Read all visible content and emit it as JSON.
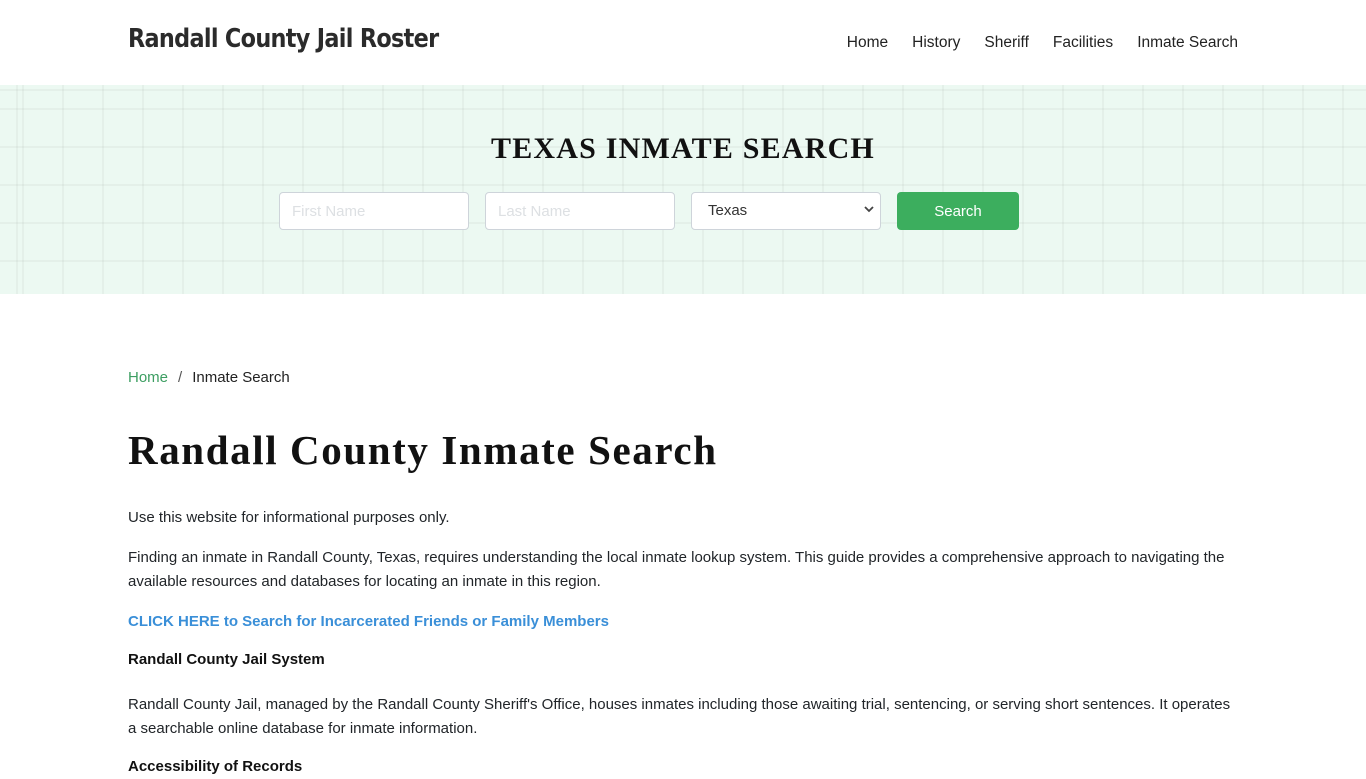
{
  "header": {
    "brand": "Randall County Jail Roster",
    "nav": [
      {
        "label": "Home"
      },
      {
        "label": "History"
      },
      {
        "label": "Sheriff"
      },
      {
        "label": "Facilities"
      },
      {
        "label": "Inmate Search"
      }
    ]
  },
  "hero": {
    "title": "TEXAS INMATE SEARCH",
    "first_name": {
      "placeholder": "First Name",
      "value": ""
    },
    "last_name": {
      "placeholder": "Last Name",
      "value": ""
    },
    "state_select": {
      "selected": "Texas",
      "icon": "chevron-down-icon"
    },
    "search_button": "Search",
    "colors": {
      "background": "#ecf9f2",
      "button": "#3cae5e"
    }
  },
  "breadcrumb": {
    "home": "Home",
    "separator": "/",
    "current": "Inmate Search"
  },
  "main": {
    "title": "Randall County Inmate Search",
    "intro": "Use this website for informational purposes only.",
    "paragraph1": "Finding an inmate in Randall County, Texas, requires understanding the local inmate lookup system. This guide provides a comprehensive approach to navigating the available resources and databases for locating an inmate in this region.",
    "cta_link": "CLICK HERE to Search for Incarcerated Friends or Family Members",
    "section1_heading": "Randall County Jail System",
    "section1_text": "Randall County Jail, managed by the Randall County Sheriff's Office, houses inmates including those awaiting trial, sentencing, or serving short sentences. It operates a searchable online database for inmate information.",
    "section2_heading": "Accessibility of Records",
    "link_color": "#3a8fd8"
  }
}
